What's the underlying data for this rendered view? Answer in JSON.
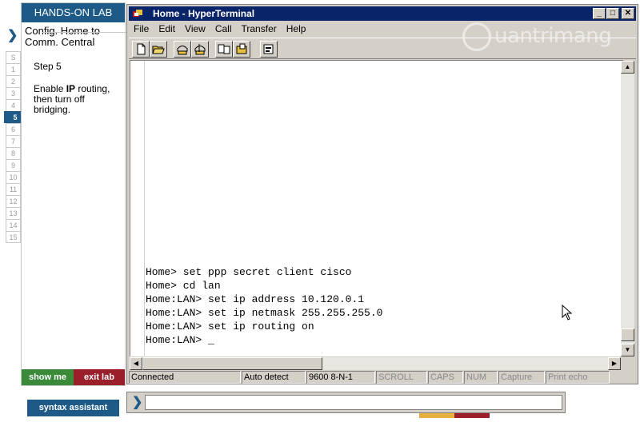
{
  "lab": {
    "header": "HANDS-ON LAB",
    "title_line1": "Config. Home to",
    "title_line2": "Comm. Central",
    "step_label": "Step 5",
    "step_text_pre": "Enable ",
    "step_text_bold": "IP",
    "step_text_post": " routing, then turn off bridging.",
    "step_numbers": [
      "S",
      "1",
      "2",
      "3",
      "4",
      "5",
      "6",
      "7",
      "8",
      "9",
      "10",
      "11",
      "12",
      "13",
      "14",
      "15"
    ],
    "active_step": "5",
    "show_me_label": "show me",
    "exit_lab_label": "exit lab",
    "syntax_assistant_label": "syntax assistant",
    "command_input_value": ""
  },
  "window": {
    "title": "Home  - HyperTerminal",
    "menu": [
      "File",
      "Edit",
      "View",
      "Call",
      "Transfer",
      "Help"
    ],
    "toolbar_icons": [
      "new-icon",
      "open-icon",
      "call-icon",
      "disconnect-icon",
      "send-icon",
      "receive-icon",
      "properties-icon"
    ],
    "terminal_lines": [
      "Home> set ppp secret client cisco",
      "Home> cd lan",
      "Home:LAN> set ip address 10.120.0.1",
      "Home:LAN> set ip netmask 255.255.255.0",
      "Home:LAN> set ip routing on",
      "Home:LAN> _"
    ],
    "status": {
      "connected": "Connected",
      "detect": "Auto detect",
      "settings": "9600 8-N-1",
      "scroll": "SCROLL",
      "caps": "CAPS",
      "num": "NUM",
      "capture": "Capture",
      "print_echo": "Print echo"
    }
  },
  "watermark": {
    "text": "uantrimang"
  },
  "colors": {
    "lab_blue": "#1e5a88",
    "show_me_green": "#3a8a3a",
    "exit_red": "#9a1f2a",
    "titlebar": "#0a246a",
    "chrome": "#d4d0c8"
  }
}
